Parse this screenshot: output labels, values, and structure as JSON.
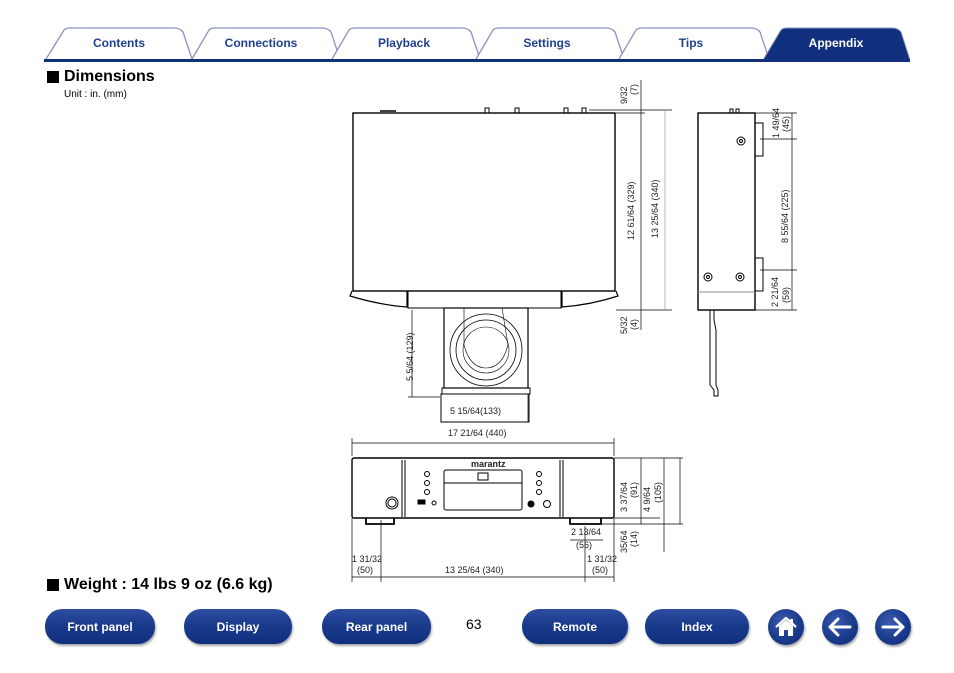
{
  "tabs": [
    {
      "label": "Contents",
      "active": false
    },
    {
      "label": "Connections",
      "active": false
    },
    {
      "label": "Playback",
      "active": false
    },
    {
      "label": "Settings",
      "active": false
    },
    {
      "label": "Tips",
      "active": false
    },
    {
      "label": "Appendix",
      "active": true
    }
  ],
  "colors": {
    "brand_blue": "#10307e",
    "tab_text": "#1f3f8f",
    "tab_outline": "#8a93c4"
  },
  "sections": {
    "dimensions_title": "Dimensions",
    "unit_note": "Unit : in. (mm)",
    "weight_title": "Weight : 14 lbs 9 oz (6.6 kg)"
  },
  "dimensions": {
    "top_view": {
      "rear_protrusion": {
        "in": "9/32",
        "mm": "(7)"
      },
      "body_depth": "12 61/64 (329)",
      "total_depth": "13 25/64 (340)",
      "front_protrusion": {
        "in": "5/32",
        "mm": "(4)"
      },
      "tray_depth": "5 5/64 (129)",
      "tray_width": "5 15/64(133)"
    },
    "side_view": {
      "top_to_foot": {
        "in": "1 49/64",
        "mm": "(45)"
      },
      "foot_spacing": "8 55/64 (225)",
      "foot_to_front": {
        "in": "2 21/64",
        "mm": "(59)"
      }
    },
    "front_view": {
      "overall_width": "17 21/64 (440)",
      "body_height": {
        "in": "3 37/64",
        "mm": "(91)"
      },
      "total_height": {
        "in": "4 9/64",
        "mm": "(105)"
      },
      "foot_height": {
        "in": "35/64",
        "mm": "(14)"
      },
      "foot_width": {
        "in": "2 13/64",
        "mm": "(56)"
      },
      "left_offset": {
        "in": "1 31/32",
        "mm": "(50)"
      },
      "foot_spacing": "13 25/64 (340)",
      "right_offset": {
        "in": "1 31/32",
        "mm": "(50)"
      },
      "brand": "marantz"
    }
  },
  "footer": {
    "buttons": [
      "Front panel",
      "Display",
      "Rear panel",
      "Remote",
      "Index"
    ],
    "page_number": "63",
    "icons": [
      "home-icon",
      "back-arrow-icon",
      "forward-arrow-icon"
    ]
  }
}
